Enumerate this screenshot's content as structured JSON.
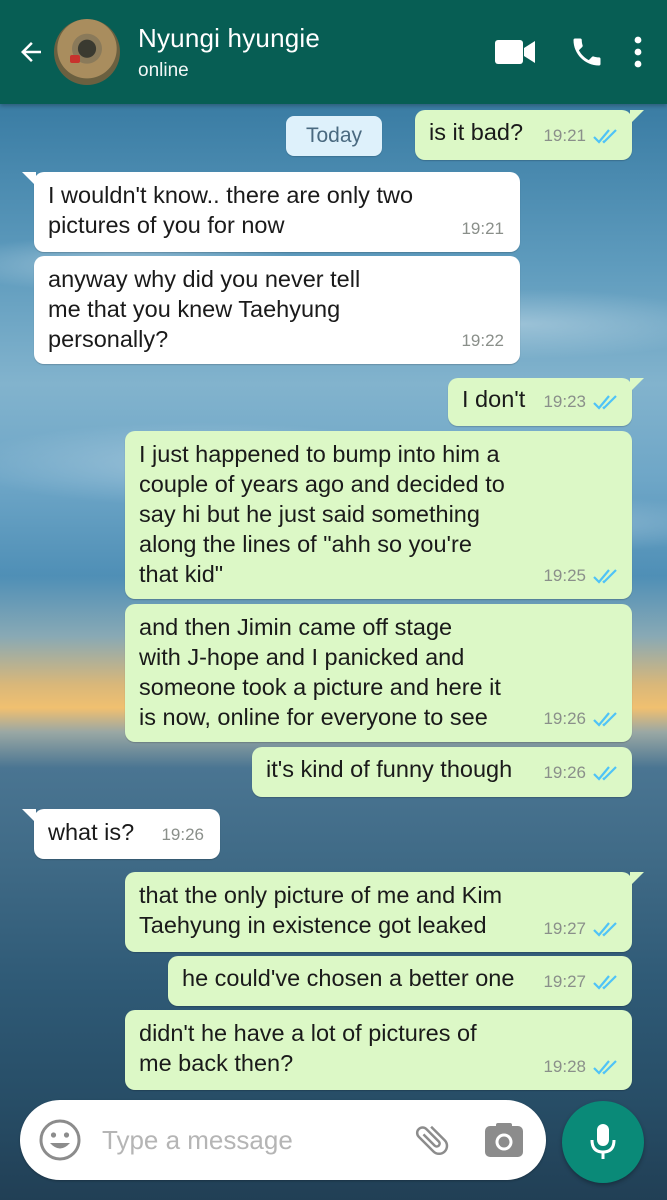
{
  "header": {
    "contact_name": "Nyungi hyungie",
    "status": "online"
  },
  "chat": {
    "date_chip": "Today",
    "messages": [
      {
        "dir": "out",
        "text": "is it bad?",
        "time": "19:21",
        "ticks": "read"
      },
      {
        "dir": "in",
        "text": "I wouldn't know.. there are only two\npictures of you for now",
        "time": "19:21"
      },
      {
        "dir": "in",
        "text": "anyway why did you never tell\nme that you knew Taehyung\npersonally?",
        "time": "19:22"
      },
      {
        "dir": "out",
        "text": "I don't",
        "time": "19:23",
        "ticks": "read"
      },
      {
        "dir": "out",
        "text": "I just happened to bump into him a\ncouple of years ago and decided to\nsay hi but he just said something\nalong the lines of \"ahh so you're\nthat kid\"",
        "time": "19:25",
        "ticks": "read"
      },
      {
        "dir": "out",
        "text": "and then Jimin came off stage\nwith J-hope and I panicked and\nsomeone took a picture and here it\nis now, online for everyone to see",
        "time": "19:26",
        "ticks": "read"
      },
      {
        "dir": "out",
        "text": "it's kind of funny though",
        "time": "19:26",
        "ticks": "read"
      },
      {
        "dir": "in",
        "text": "what is?",
        "time": "19:26"
      },
      {
        "dir": "out",
        "text": "that the only picture of me and Kim\nTaehyung in existence got leaked",
        "time": "19:27",
        "ticks": "read"
      },
      {
        "dir": "out",
        "text": "he could've chosen a better one",
        "time": "19:27",
        "ticks": "read"
      },
      {
        "dir": "out",
        "text": "didn't he have a lot of pictures of\nme back then?",
        "time": "19:28",
        "ticks": "read"
      }
    ]
  },
  "composer": {
    "placeholder": "Type a message"
  },
  "icons": {
    "back": "arrow-left-icon",
    "video": "video-camera-icon",
    "call": "phone-icon",
    "more": "more-vertical-icon",
    "emoji": "emoji-icon",
    "attach": "paperclip-icon",
    "camera": "camera-icon",
    "mic": "microphone-icon",
    "ticks": "double-check-icon"
  },
  "colors": {
    "header": "#075e54",
    "outgoing_bubble": "#dcf8c6",
    "incoming_bubble": "#ffffff",
    "read_ticks": "#4fc3f7",
    "mic_button": "#0a8a78"
  }
}
